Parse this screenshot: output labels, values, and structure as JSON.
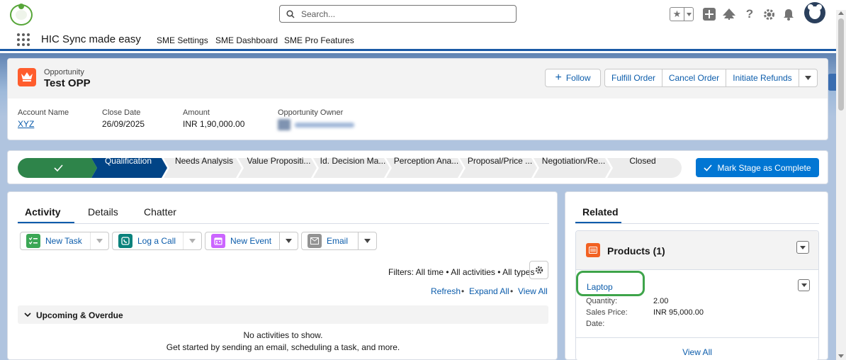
{
  "search": {
    "placeholder": "Search..."
  },
  "app": {
    "name": "HIC Sync made easy",
    "nav": [
      "SME Settings",
      "SME Dashboard",
      "SME Pro Features"
    ]
  },
  "record": {
    "type": "Opportunity",
    "name": "Test OPP",
    "actions": {
      "follow": "Follow",
      "fulfill": "Fulfill Order",
      "cancel": "Cancel Order",
      "refunds": "Initiate Refunds"
    },
    "fields": {
      "account_label": "Account Name",
      "account_value": "XYZ",
      "close_label": "Close Date",
      "close_value": "26/09/2025",
      "amount_label": "Amount",
      "amount_value": "INR 1,90,000.00",
      "owner_label": "Opportunity Owner"
    }
  },
  "path": {
    "stages": [
      "Qualification",
      "Needs Analysis",
      "Value Propositi...",
      "Id. Decision Ma...",
      "Perception Ana...",
      "Proposal/Price ...",
      "Negotiation/Re...",
      "Closed"
    ],
    "current_index": 0,
    "mark_complete": "Mark Stage as Complete"
  },
  "activity": {
    "tabs": [
      "Activity",
      "Details",
      "Chatter"
    ],
    "buttons": {
      "new_task": "New Task",
      "log_call": "Log a Call",
      "new_event": "New Event",
      "email": "Email"
    },
    "filters": "Filters: All time • All activities • All types",
    "links": {
      "refresh": "Refresh",
      "expand_all": "Expand All",
      "view_all": "View All",
      "sep": "•"
    },
    "upcoming_title": "Upcoming & Overdue",
    "empty_title": "No activities to show.",
    "empty_sub": "Get started by sending an email, scheduling a task, and more."
  },
  "related": {
    "title": "Related",
    "products_title": "Products (1)",
    "product": {
      "name": "Laptop",
      "quantity_label": "Quantity:",
      "quantity_value": "2.00",
      "price_label": "Sales Price:",
      "price_value": "INR 95,000.00",
      "date_label": "Date:"
    },
    "view_all": "View All"
  },
  "colors": {
    "brand_blue": "#0176d3",
    "path_complete": "#2e844a",
    "path_current": "#014486",
    "opportunity_icon": "#ff5d2d",
    "highlight_green": "#3ea44a"
  }
}
